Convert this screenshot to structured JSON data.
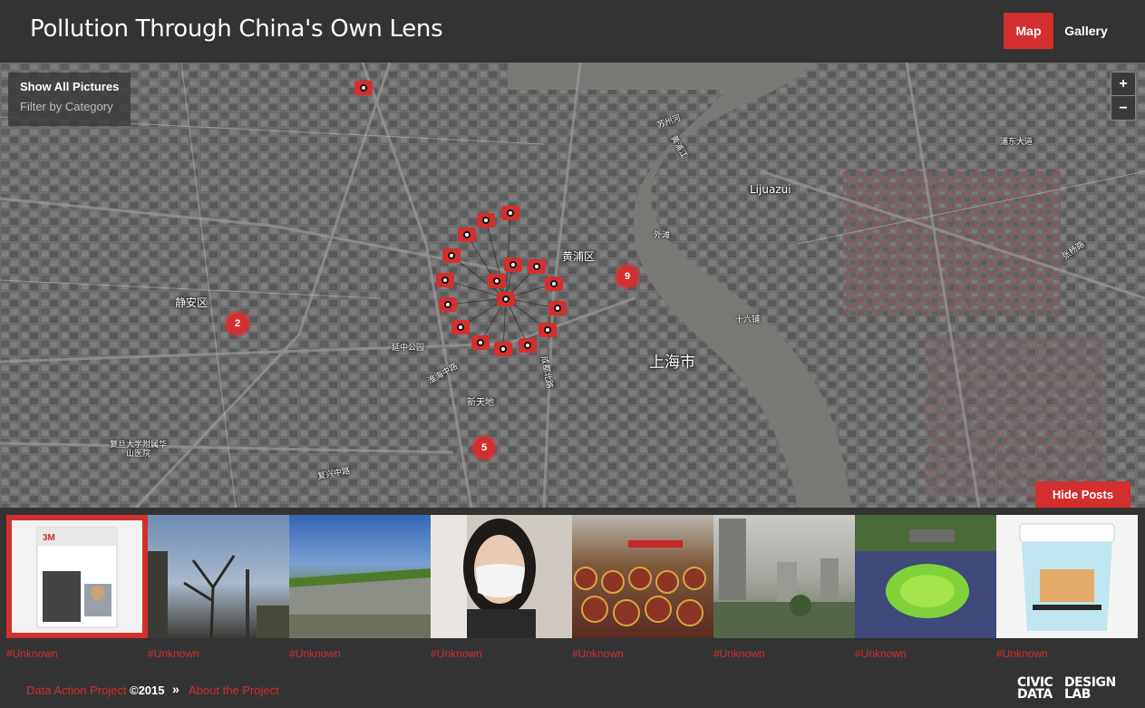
{
  "header": {
    "title": "Pollution Through China's Own Lens",
    "nav": {
      "map": "Map",
      "gallery": "Gallery"
    },
    "accent_color": "#d32f2f"
  },
  "map": {
    "filter": {
      "show_all": "Show All Pictures",
      "by_category": "Filter by Category"
    },
    "zoom": {
      "in": "+",
      "out": "−"
    },
    "clusters": [
      "2",
      "9",
      "5"
    ],
    "labels": {
      "jingan": "静安区",
      "huangpu": "黄浦区",
      "shanghai": "上海市",
      "lujiazui": "Lijuazui",
      "xintiandi": "新天地",
      "fudan": "复旦大学附属华\n山医院",
      "yanan": "延中公园",
      "shiliupu": "十六铺",
      "waitan": "外滩",
      "pudong": "浦东大道",
      "suzhou": "苏州河",
      "huaihai": "淮海中路",
      "fuxing": "复兴中路",
      "chengdu": "成都北路",
      "yuyuan": "张杨路",
      "binjiang": "黄浦江"
    },
    "hide_posts": "Hide Posts"
  },
  "gallery": {
    "items": [
      {
        "tag": "#Unknown",
        "icon": "mask-box-photo"
      },
      {
        "tag": "#Unknown",
        "icon": "sky-tree-photo"
      },
      {
        "tag": "#Unknown",
        "icon": "wall-garden-photo"
      },
      {
        "tag": "#Unknown",
        "icon": "woman-mask-photo"
      },
      {
        "tag": "#Unknown",
        "icon": "crowd-ceremony-photo"
      },
      {
        "tag": "#Unknown",
        "icon": "smoggy-city-photo"
      },
      {
        "tag": "#Unknown",
        "icon": "green-island-photo"
      },
      {
        "tag": "#Unknown",
        "icon": "bad-air-sponge-photo"
      }
    ]
  },
  "footer": {
    "data_action": "Data Action Project",
    "copyright": "©2015",
    "separator": "»",
    "about": "About the Project",
    "logo": {
      "line1a": "CIVIC",
      "line1b": "DESIGN",
      "line2a": "DATA",
      "line2b": "LAB"
    }
  }
}
